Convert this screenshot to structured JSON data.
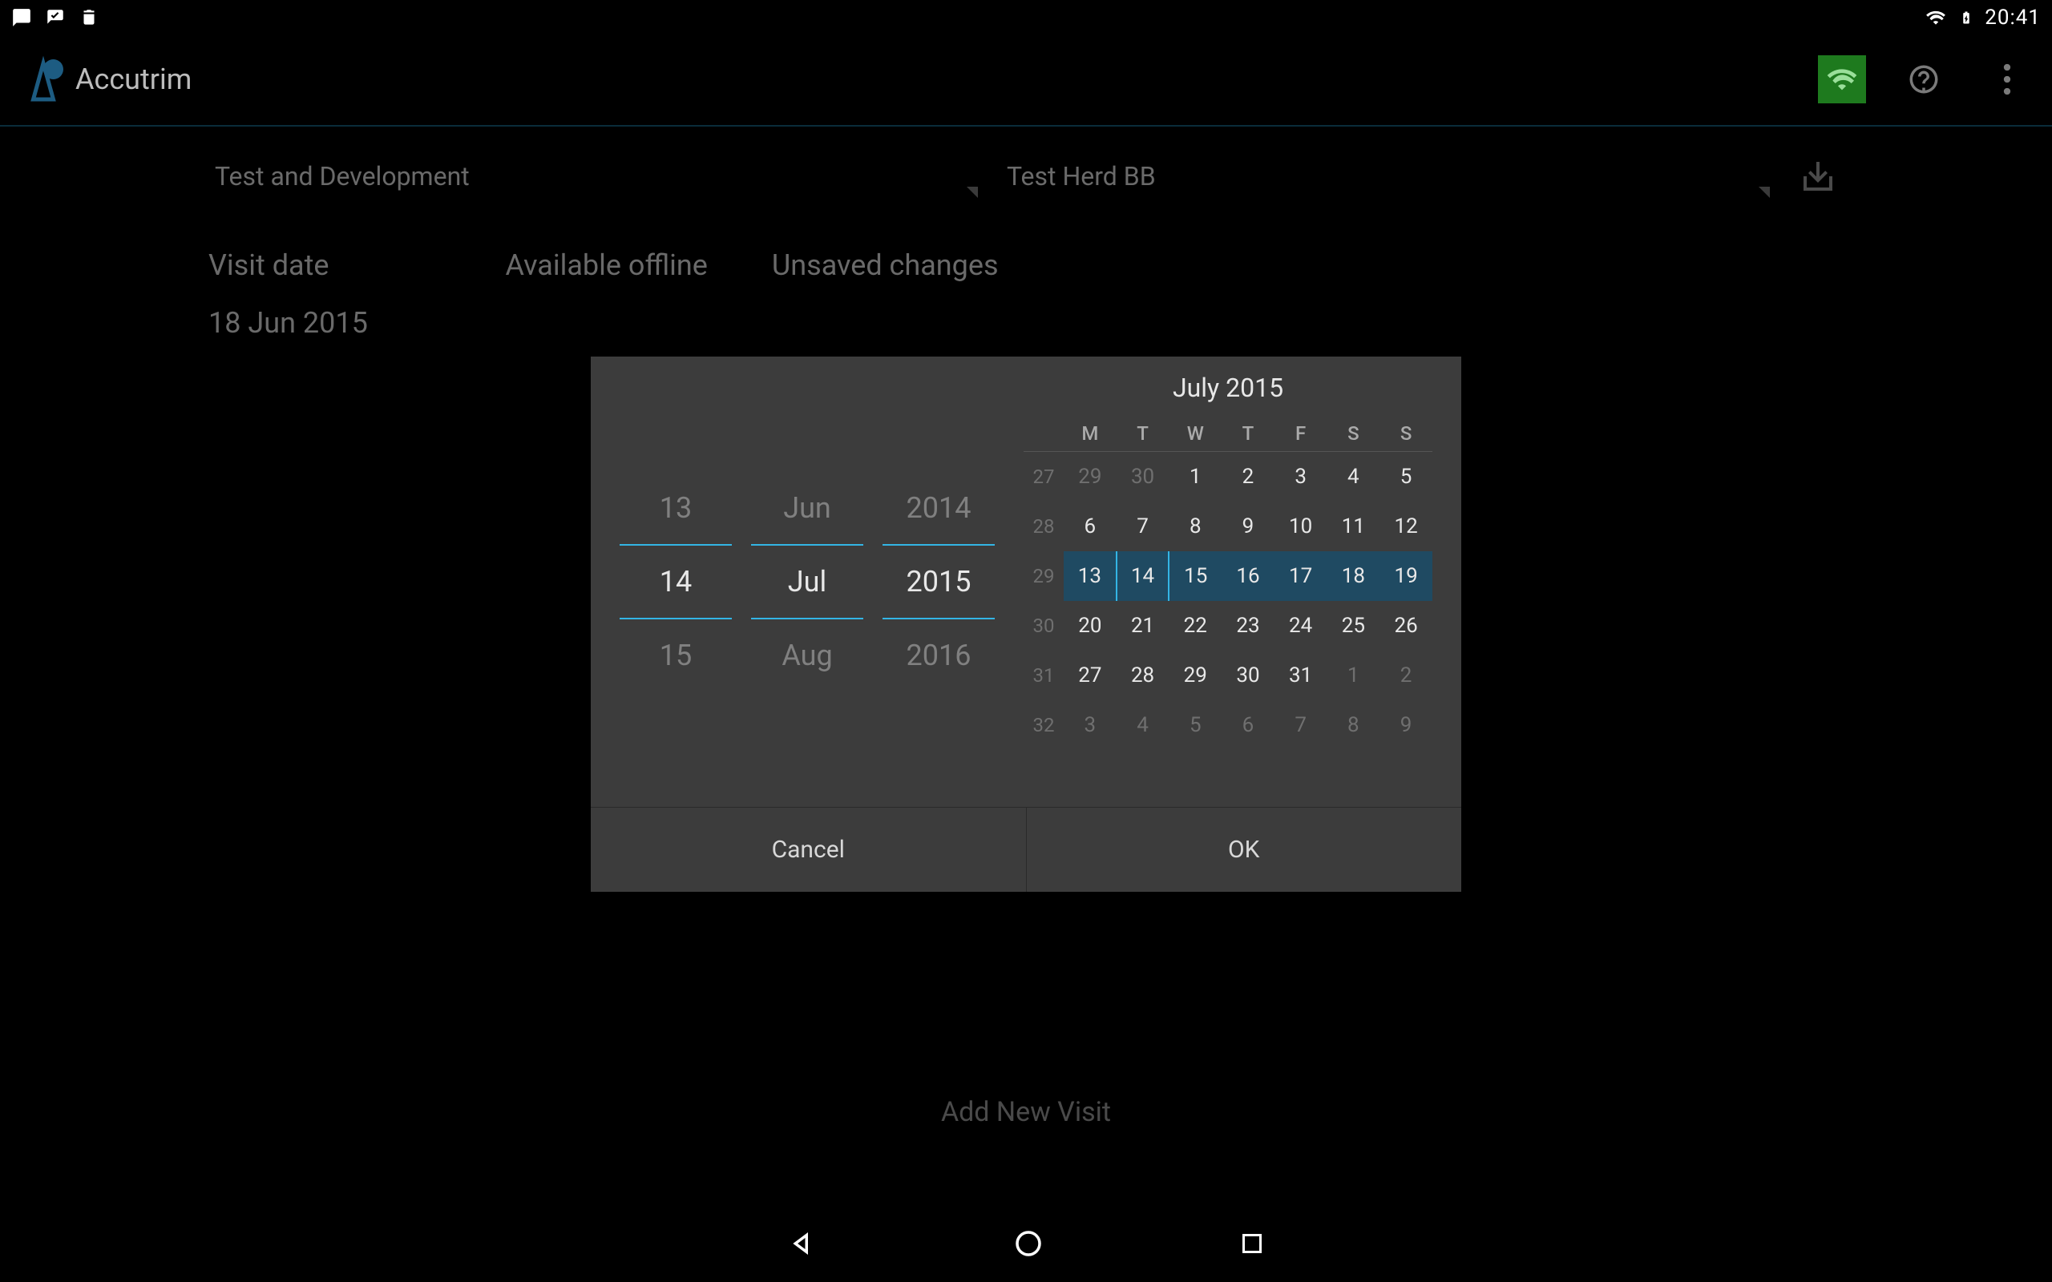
{
  "statusbar": {
    "time": "20:41"
  },
  "actionbar": {
    "title": "Accutrim"
  },
  "selectors": {
    "org": "Test and Development",
    "herd": "Test Herd BB"
  },
  "headers": {
    "visit": "Visit date",
    "offline": "Available offline",
    "unsaved": "Unsaved changes"
  },
  "visit_date": "18 Jun 2015",
  "add_visit": "Add New Visit",
  "dialog": {
    "title": "July 2015",
    "spinners": {
      "day": {
        "prev": "13",
        "cur": "14",
        "next": "15"
      },
      "month": {
        "prev": "Jun",
        "cur": "Jul",
        "next": "Aug"
      },
      "year": {
        "prev": "2014",
        "cur": "2015",
        "next": "2016"
      }
    },
    "dow": [
      "M",
      "T",
      "W",
      "T",
      "F",
      "S",
      "S"
    ],
    "weeks": [
      {
        "wk": "27",
        "days": [
          {
            "n": "29",
            "dim": true
          },
          {
            "n": "30",
            "dim": true
          },
          {
            "n": "1"
          },
          {
            "n": "2"
          },
          {
            "n": "3"
          },
          {
            "n": "4"
          },
          {
            "n": "5"
          }
        ]
      },
      {
        "wk": "28",
        "days": [
          {
            "n": "6"
          },
          {
            "n": "7"
          },
          {
            "n": "8"
          },
          {
            "n": "9"
          },
          {
            "n": "10"
          },
          {
            "n": "11"
          },
          {
            "n": "12"
          }
        ]
      },
      {
        "wk": "29",
        "days": [
          {
            "n": "13",
            "r": "start"
          },
          {
            "n": "14",
            "r": "end"
          },
          {
            "n": "15",
            "r": "range"
          },
          {
            "n": "16",
            "r": "range"
          },
          {
            "n": "17",
            "r": "range"
          },
          {
            "n": "18",
            "r": "range"
          },
          {
            "n": "19",
            "r": "range"
          }
        ]
      },
      {
        "wk": "30",
        "days": [
          {
            "n": "20"
          },
          {
            "n": "21"
          },
          {
            "n": "22"
          },
          {
            "n": "23"
          },
          {
            "n": "24"
          },
          {
            "n": "25"
          },
          {
            "n": "26"
          }
        ]
      },
      {
        "wk": "31",
        "days": [
          {
            "n": "27"
          },
          {
            "n": "28"
          },
          {
            "n": "29"
          },
          {
            "n": "30"
          },
          {
            "n": "31"
          },
          {
            "n": "1",
            "dim": true
          },
          {
            "n": "2",
            "dim": true
          }
        ]
      },
      {
        "wk": "32",
        "days": [
          {
            "n": "3",
            "dim": true
          },
          {
            "n": "4",
            "dim": true
          },
          {
            "n": "5",
            "dim": true
          },
          {
            "n": "6",
            "dim": true
          },
          {
            "n": "7",
            "dim": true
          },
          {
            "n": "8",
            "dim": true
          },
          {
            "n": "9",
            "dim": true
          }
        ]
      }
    ],
    "cancel": "Cancel",
    "ok": "OK"
  }
}
